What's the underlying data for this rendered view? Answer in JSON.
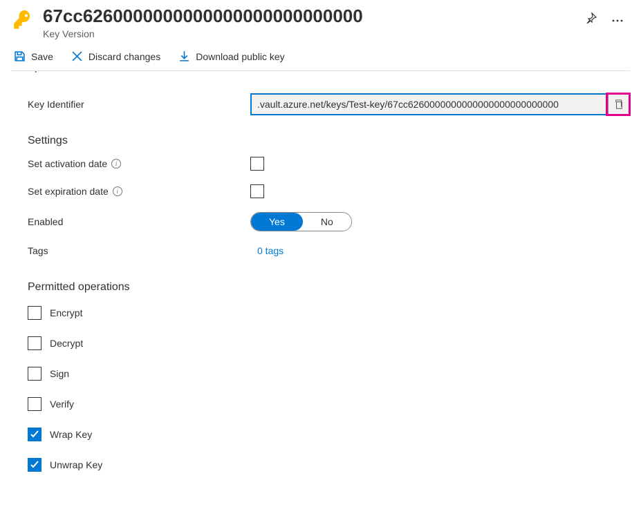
{
  "header": {
    "title": "67cc6260000000000000000000000000",
    "subtitle": "Key Version"
  },
  "toolbar": {
    "save": "Save",
    "discard": "Discard changes",
    "download": "Download public key"
  },
  "fields": {
    "updated_label": "Updated",
    "key_identifier_label": "Key Identifier",
    "key_identifier_value": ".vault.azure.net/keys/Test-key/67cc6260000000000000000000000000",
    "settings_heading": "Settings",
    "activation_label": "Set activation date",
    "expiration_label": "Set expiration date",
    "enabled_label": "Enabled",
    "enabled_yes": "Yes",
    "enabled_no": "No",
    "tags_label": "Tags",
    "tags_link": "0 tags",
    "permitted_heading": "Permitted operations"
  },
  "operations": [
    {
      "label": "Encrypt",
      "checked": false
    },
    {
      "label": "Decrypt",
      "checked": false
    },
    {
      "label": "Sign",
      "checked": false
    },
    {
      "label": "Verify",
      "checked": false
    },
    {
      "label": "Wrap Key",
      "checked": true
    },
    {
      "label": "Unwrap Key",
      "checked": true
    }
  ]
}
